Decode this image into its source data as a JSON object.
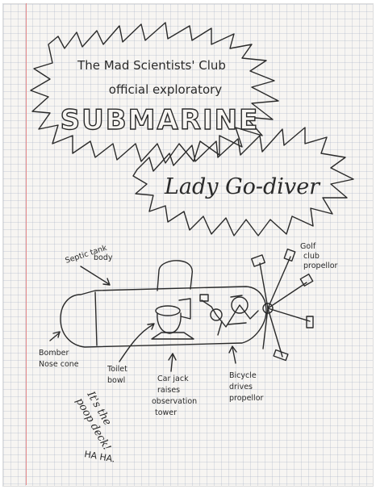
{
  "title": {
    "line1": "The Mad Scientists' Club",
    "line2": "official exploratory",
    "line3": "SUBMARINE",
    "name": "Lady Go-diver"
  },
  "labels": {
    "septic_1": "Septic tank",
    "septic_2": "body",
    "golf_1": "Golf",
    "golf_2": "club",
    "golf_3": "propellor",
    "bomber_1": "Bomber",
    "bomber_2": "Nose cone",
    "toilet_1": "Toilet",
    "toilet_2": "bowl",
    "carjack_1": "Car jack",
    "carjack_2": "raises",
    "carjack_3": "observation",
    "carjack_4": "tower",
    "bicycle_1": "Bicycle",
    "bicycle_2": "drives",
    "bicycle_3": "propellor",
    "poop_1": "It's the",
    "poop_2": "poop deck!",
    "haha": "HA HA."
  },
  "colors": {
    "ink": "#2a2a2a",
    "paper": "#f7f5f2",
    "grid": "#a0aabe",
    "margin": "#e58a8a"
  }
}
